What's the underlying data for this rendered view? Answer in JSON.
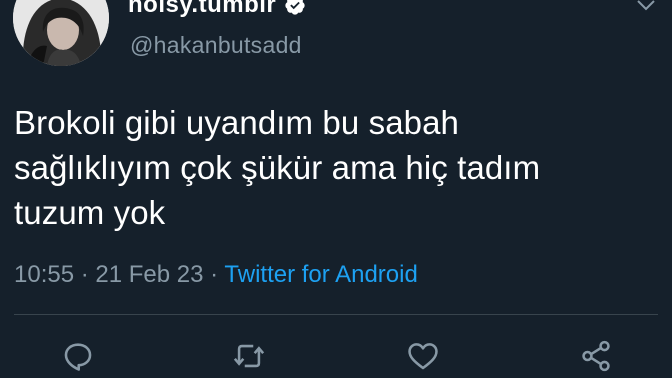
{
  "tweet": {
    "display_name": "noisy.tumblr",
    "verified": true,
    "handle": "@hakanbutsadd",
    "text_lines": [
      "Brokoli gibi uyandım bu sabah",
      "sağlıklıyım çok şükür ama hiç tadım",
      "tuzum yok"
    ],
    "time": "10:55",
    "date": "21 Feb 23",
    "separator": "·",
    "source": "Twitter for Android"
  },
  "actions": [
    {
      "icon": "reply-icon"
    },
    {
      "icon": "retweet-icon"
    },
    {
      "icon": "like-icon"
    },
    {
      "icon": "share-icon"
    }
  ],
  "colors": {
    "background": "#15202b",
    "primary_text": "#ffffff",
    "secondary_text": "#8899a6",
    "link": "#1da1f2",
    "divider": "#38444d"
  }
}
